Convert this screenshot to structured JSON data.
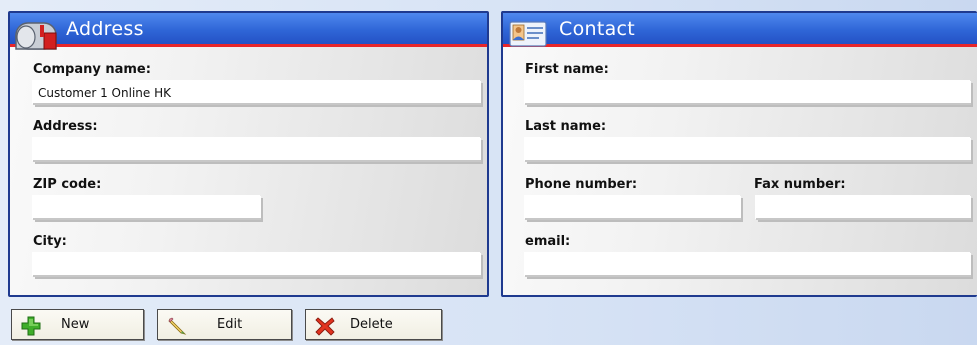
{
  "address_panel": {
    "title": "Address",
    "company_name_label": "Company name:",
    "company_name_value": "Customer 1 Online HK",
    "address_label": "Address:",
    "address_value": "",
    "zip_label": "ZIP code:",
    "zip_value": "",
    "city_label": "City:",
    "city_value": ""
  },
  "contact_panel": {
    "title": "Contact",
    "first_name_label": "First name:",
    "first_name_value": "",
    "last_name_label": "Last name:",
    "last_name_value": "",
    "phone_label": "Phone number:",
    "phone_value": "",
    "fax_label": "Fax number:",
    "fax_value": "",
    "email_label": "email:",
    "email_value": ""
  },
  "toolbar": {
    "new_label": "New",
    "edit_label": "Edit",
    "delete_label": "Delete"
  },
  "icons": {
    "address": "mailbox-icon",
    "contact": "contact-card-icon",
    "new": "plus-icon",
    "edit": "pencil-icon",
    "delete": "delete-x-icon"
  },
  "colors": {
    "header_blue": "#2f66d7",
    "header_underline": "#e8262a",
    "panel_border": "#1f3a8f"
  }
}
